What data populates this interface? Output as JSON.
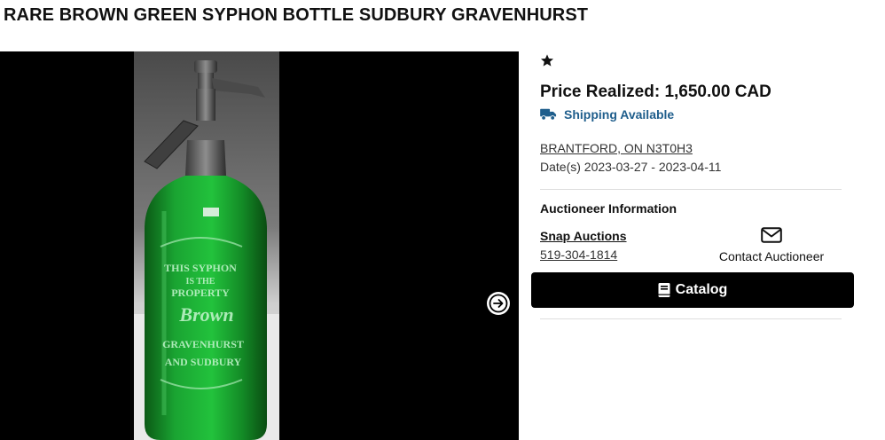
{
  "lot": {
    "title": "RARE BROWN GREEN SYPHON BOTTLE SUDBURY GRAVENHURST",
    "price_realized": "Price Realized: 1,650.00 CAD",
    "shipping": "Shipping Available",
    "location": "BRANTFORD, ON N3T0H3",
    "dates": "Date(s) 2023-03-27 - 2023-04-11"
  },
  "bottle_etching": {
    "line1": "THIS SYPHON",
    "line2": "IS THE",
    "line3": "PROPERTY",
    "line4": "Brown",
    "line5": "GRAVENHURST",
    "line6": "AND SUDBURY"
  },
  "auctioneer": {
    "heading": "Auctioneer Information",
    "name": "Snap Auctions",
    "phone": "519-304-1814",
    "contact_label": "Contact Auctioneer"
  },
  "actions": {
    "catalog_label": "Catalog"
  },
  "icons": {
    "favorite": "star-icon",
    "shipping": "truck-icon",
    "contact": "envelope-icon",
    "catalog": "book-icon",
    "next": "arrow-right-icon"
  },
  "colors": {
    "shipping_text": "#1f5e8c",
    "catalog_bg": "#000000",
    "bottle_glass": "#1a9a2e"
  }
}
